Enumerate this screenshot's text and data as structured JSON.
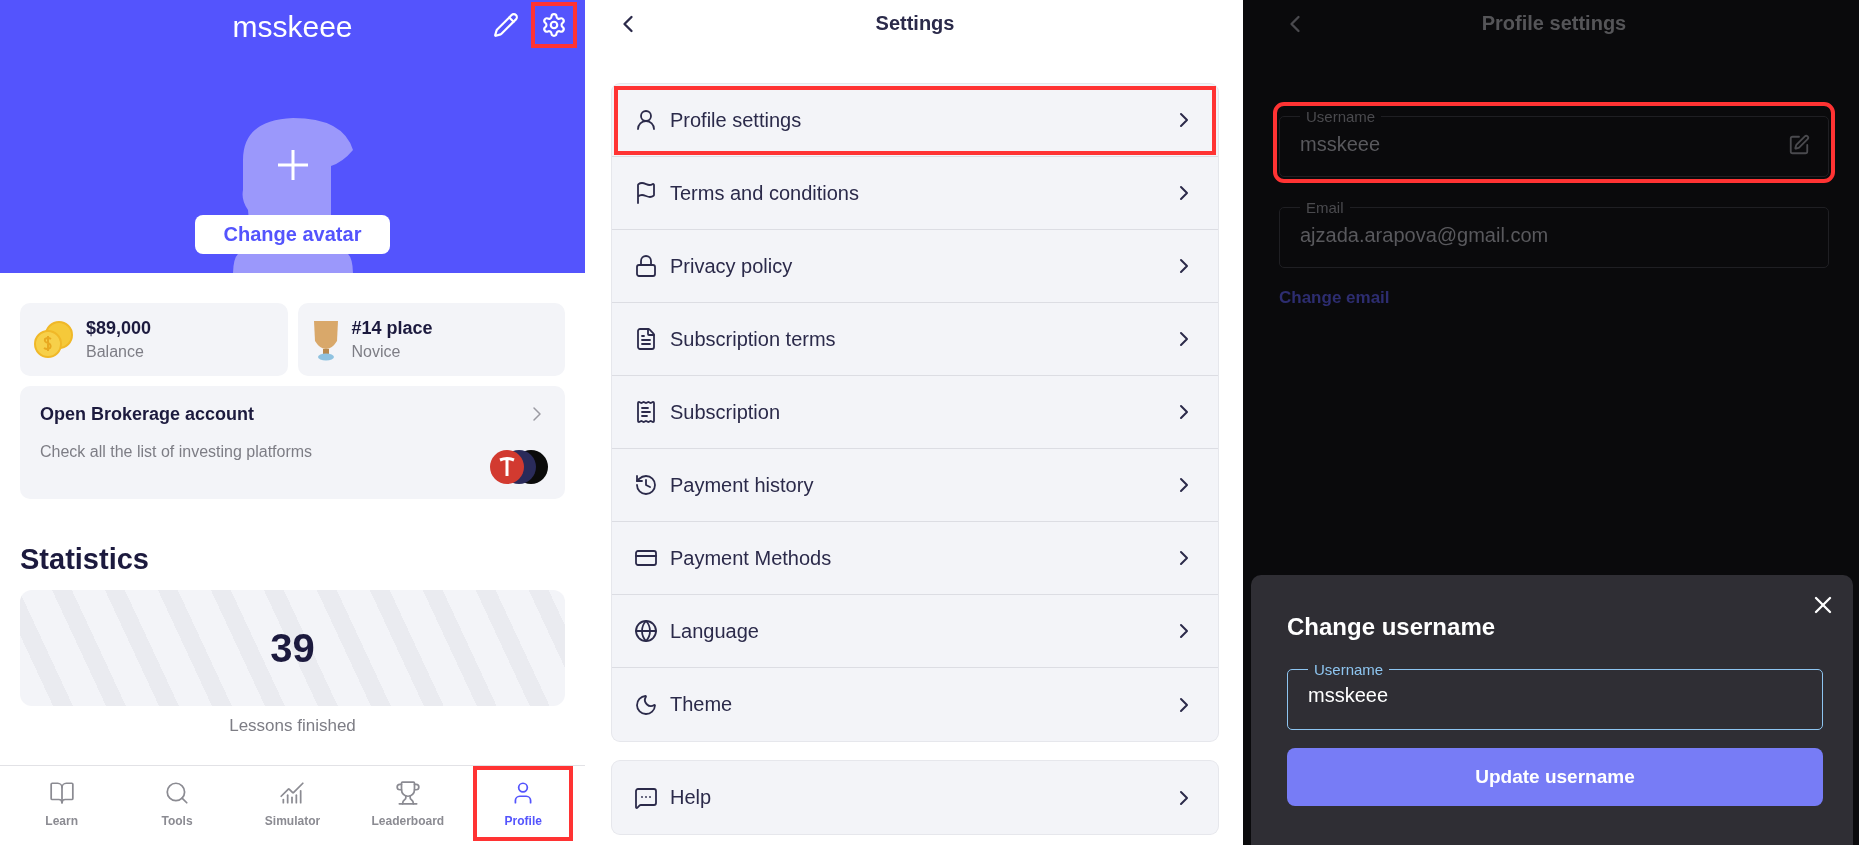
{
  "profile": {
    "username": "msskeee",
    "settings_highlighted": true,
    "avatar_button": "Change avatar",
    "stats": [
      {
        "value": "$89,000",
        "label": "Balance"
      },
      {
        "value": "#14 place",
        "label": "Novice"
      }
    ],
    "brokerage": {
      "title": "Open Brokerage account",
      "subtitle": "Check all the list of investing platforms"
    },
    "statistics": {
      "heading": "Statistics",
      "value": "39",
      "caption": "Lessons finished"
    },
    "nav": [
      {
        "label": "Learn",
        "selected": false,
        "highlighted": false
      },
      {
        "label": "Tools",
        "selected": false,
        "highlighted": false
      },
      {
        "label": "Simulator",
        "selected": false,
        "highlighted": false
      },
      {
        "label": "Leaderboard",
        "selected": false,
        "highlighted": false
      },
      {
        "label": "Profile",
        "selected": true,
        "highlighted": true
      }
    ]
  },
  "settings": {
    "title": "Settings",
    "items": [
      {
        "label": "Profile settings",
        "highlighted": true
      },
      {
        "label": "Terms and conditions",
        "highlighted": false
      },
      {
        "label": "Privacy policy",
        "highlighted": false
      },
      {
        "label": "Subscription terms",
        "highlighted": false
      },
      {
        "label": "Subscription",
        "highlighted": false
      },
      {
        "label": "Payment history",
        "highlighted": false
      },
      {
        "label": "Payment Methods",
        "highlighted": false
      },
      {
        "label": "Language",
        "highlighted": false
      },
      {
        "label": "Theme",
        "highlighted": false
      }
    ],
    "help": {
      "label": "Help",
      "highlighted": false
    }
  },
  "profile_settings": {
    "title": "Profile settings",
    "fields": [
      {
        "label": "Username",
        "value": "msskeee",
        "editable": true,
        "highlighted": true
      },
      {
        "label": "Email",
        "value": "ajzada.arapova@gmail.com",
        "editable": false,
        "highlighted": false
      }
    ],
    "change_email": "Change email",
    "dialog": {
      "title": "Change username",
      "field": {
        "label": "Username",
        "value": "msskeee",
        "focused": true
      },
      "button": "Update username"
    }
  }
}
